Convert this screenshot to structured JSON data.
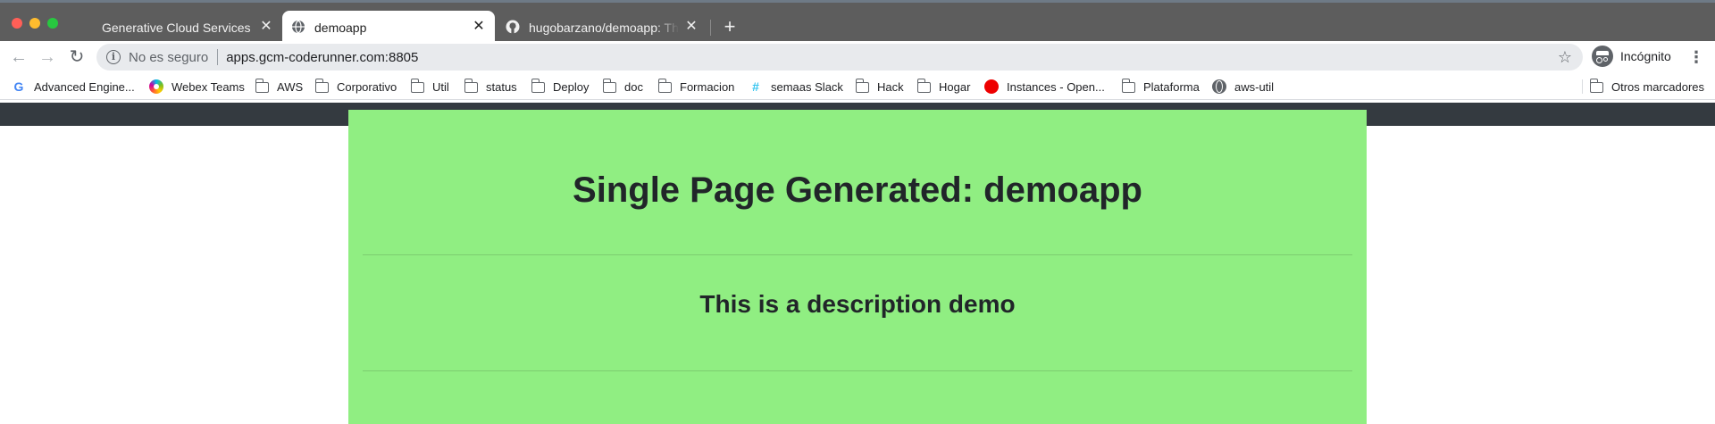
{
  "browser": {
    "tabs": [
      {
        "title": "Generative Cloud Services",
        "active": false
      },
      {
        "title": "demoapp",
        "active": true
      },
      {
        "title": "hugobarzano/demoapp: This is",
        "active": false
      }
    ],
    "new_tab_icon": "plus-icon",
    "address_bar": {
      "security_label": "No es seguro",
      "url": "apps.gcm-coderunner.com:8805"
    },
    "profile_label": "Incógnito"
  },
  "bookmarks": {
    "items": [
      {
        "label": "Advanced Engine...",
        "icon": "google-icon"
      },
      {
        "label": "Webex Teams",
        "icon": "webex-icon"
      },
      {
        "label": "AWS",
        "icon": "folder-icon"
      },
      {
        "label": "Corporativo",
        "icon": "folder-icon"
      },
      {
        "label": "Util",
        "icon": "folder-icon"
      },
      {
        "label": "status",
        "icon": "folder-icon"
      },
      {
        "label": "Deploy",
        "icon": "folder-icon"
      },
      {
        "label": "doc",
        "icon": "folder-icon"
      },
      {
        "label": "Formacion",
        "icon": "folder-icon"
      },
      {
        "label": "semaas Slack",
        "icon": "slack-icon"
      },
      {
        "label": "Hack",
        "icon": "folder-icon"
      },
      {
        "label": "Hogar",
        "icon": "folder-icon"
      },
      {
        "label": "Instances - Open...",
        "icon": "redhat-icon"
      },
      {
        "label": "Plataforma",
        "icon": "folder-icon"
      },
      {
        "label": "aws-util",
        "icon": "globe-icon"
      }
    ],
    "other_label": "Otros marcadores"
  },
  "page": {
    "title": "Single Page Generated: demoapp",
    "description": "This is a description demo",
    "colors": {
      "navbar": "#343a40",
      "card": "#90ee82",
      "text": "#212529"
    }
  }
}
